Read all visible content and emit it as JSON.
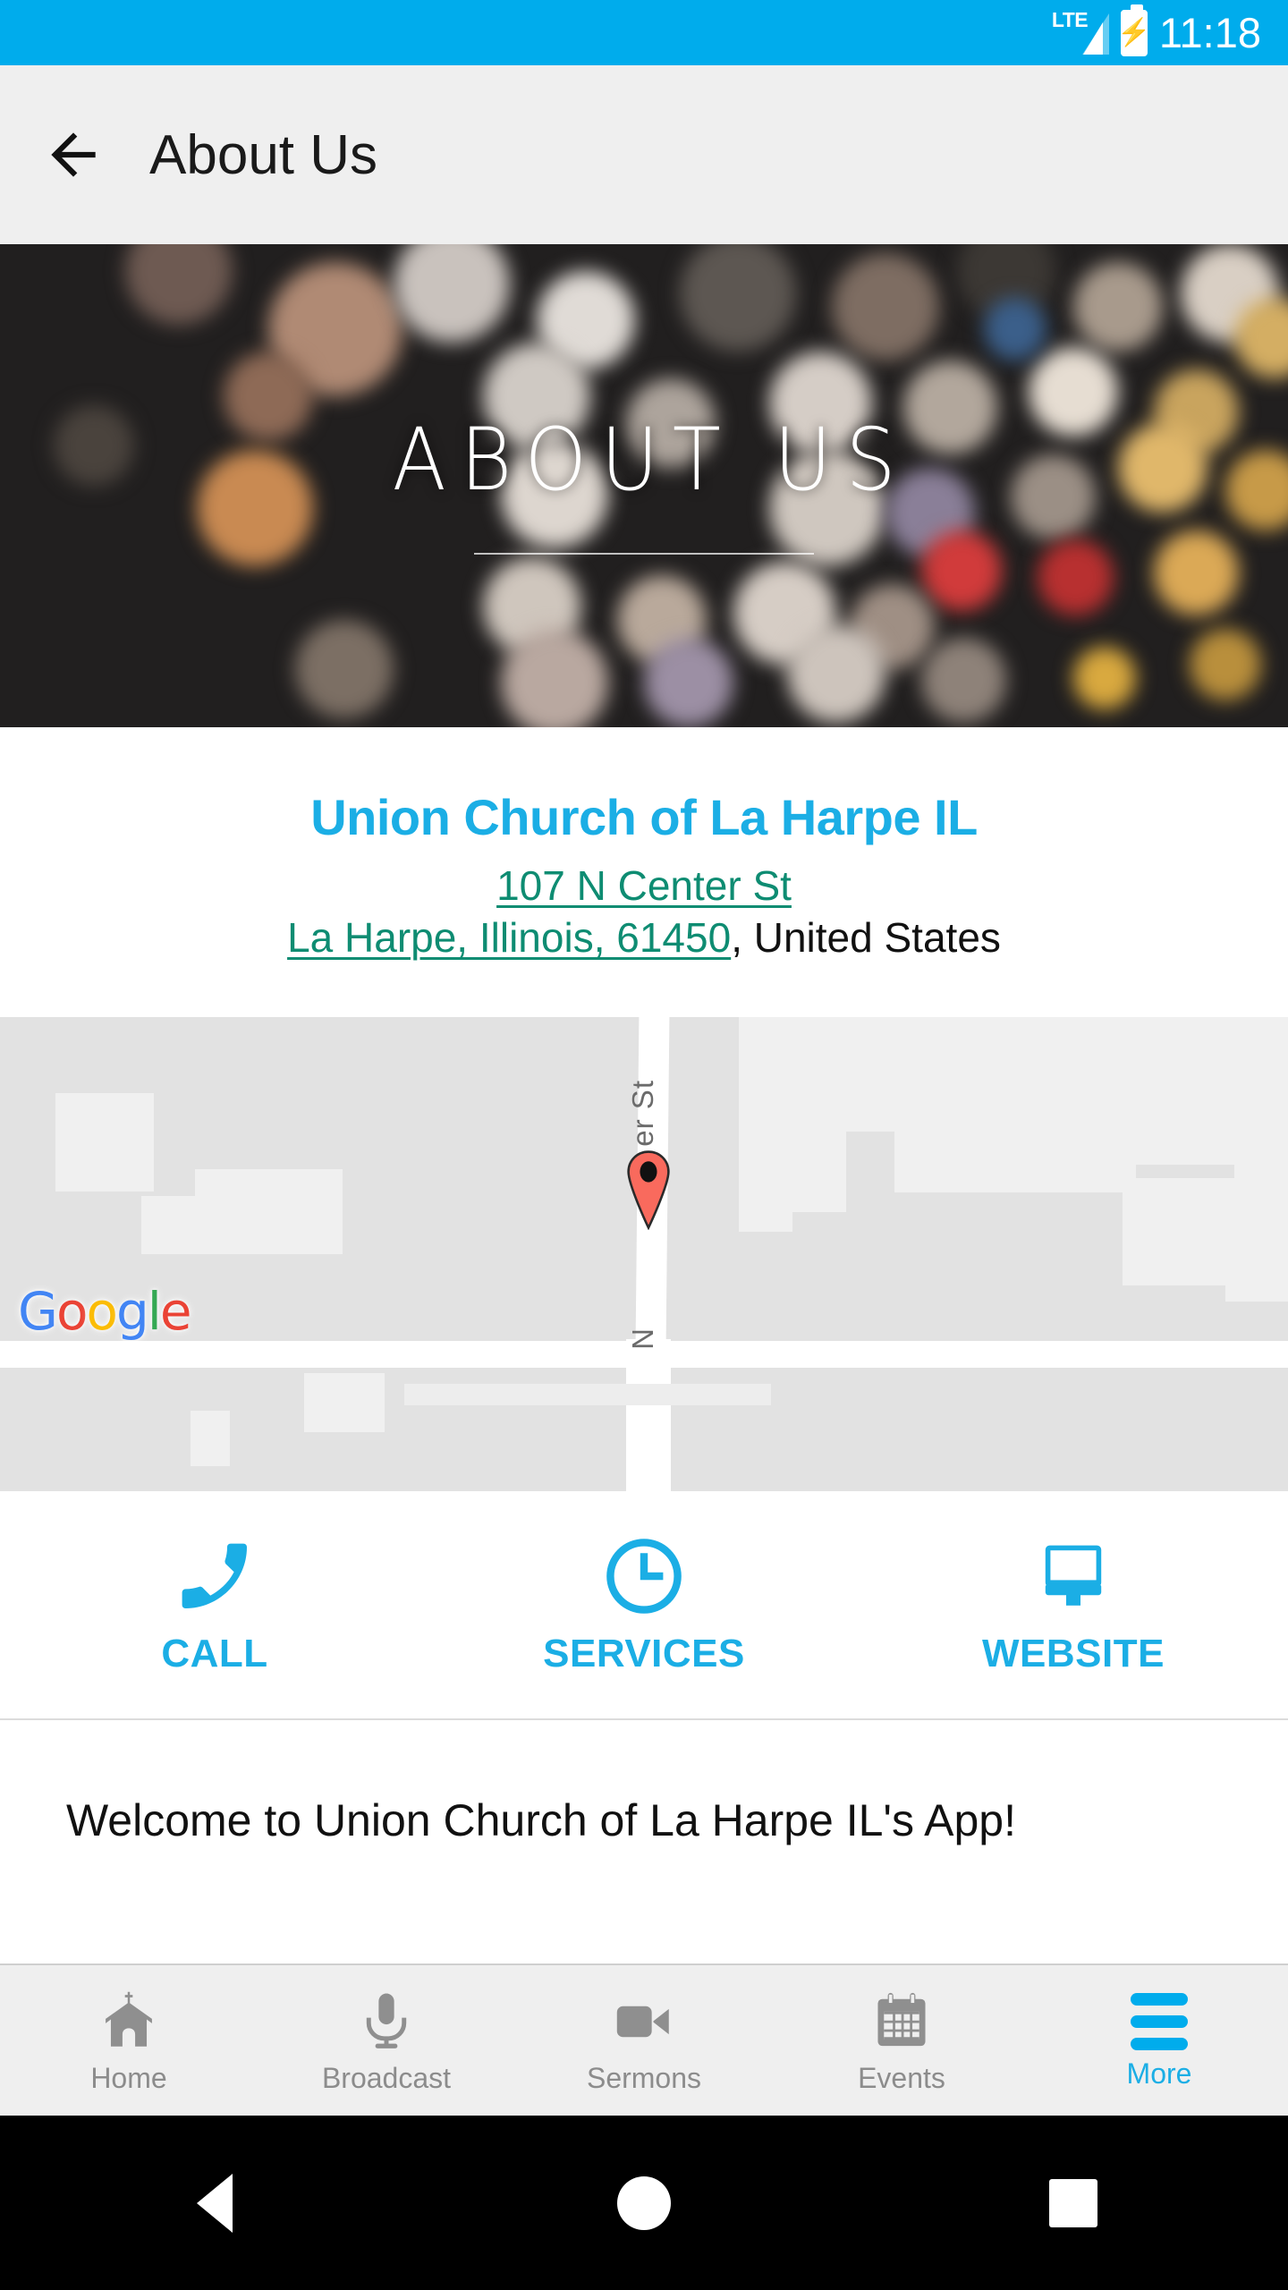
{
  "status_bar": {
    "network_label": "LTE",
    "time": "11:18",
    "battery_icon": "battery-charging-icon",
    "signal_icon": "signal-icon",
    "background_color": "#00ACEC"
  },
  "app_bar": {
    "back_icon": "back-arrow-icon",
    "title": "About Us",
    "background_color": "#efefef"
  },
  "hero": {
    "title": "ABOUT US",
    "background_color": "#211f1f"
  },
  "address_card": {
    "org_name": "Union Church of La Harpe IL",
    "street": "107 N Center St",
    "city_state_zip": "La Harpe, Illinois, 61450",
    "country": ", United States",
    "org_name_color": "#1BAEE5",
    "link_color": "#0E8C72"
  },
  "map": {
    "street_label": "er St",
    "street_label_lower": "N",
    "attribution": "Google",
    "marker_icon": "map-pin-icon",
    "google_letters": [
      "G",
      "o",
      "o",
      "g",
      "l",
      "e"
    ]
  },
  "actions": [
    {
      "label": "CALL",
      "icon": "phone-icon"
    },
    {
      "label": "SERVICES",
      "icon": "clock-icon"
    },
    {
      "label": "WEBSITE",
      "icon": "monitor-icon"
    }
  ],
  "welcome": {
    "text": "Welcome to Union Church of La Harpe IL's App!"
  },
  "tabs": [
    {
      "label": "Home",
      "icon": "church-icon",
      "active": false
    },
    {
      "label": "Broadcast",
      "icon": "microphone-icon",
      "active": false
    },
    {
      "label": "Sermons",
      "icon": "video-camera-icon",
      "active": false
    },
    {
      "label": "Events",
      "icon": "calendar-icon",
      "active": false
    },
    {
      "label": "More",
      "icon": "hamburger-menu-icon",
      "active": true
    }
  ],
  "android_nav": {
    "back": "nav-back-icon",
    "home": "nav-home-icon",
    "recents": "nav-recents-icon"
  },
  "accent_color": "#1BAEE5"
}
